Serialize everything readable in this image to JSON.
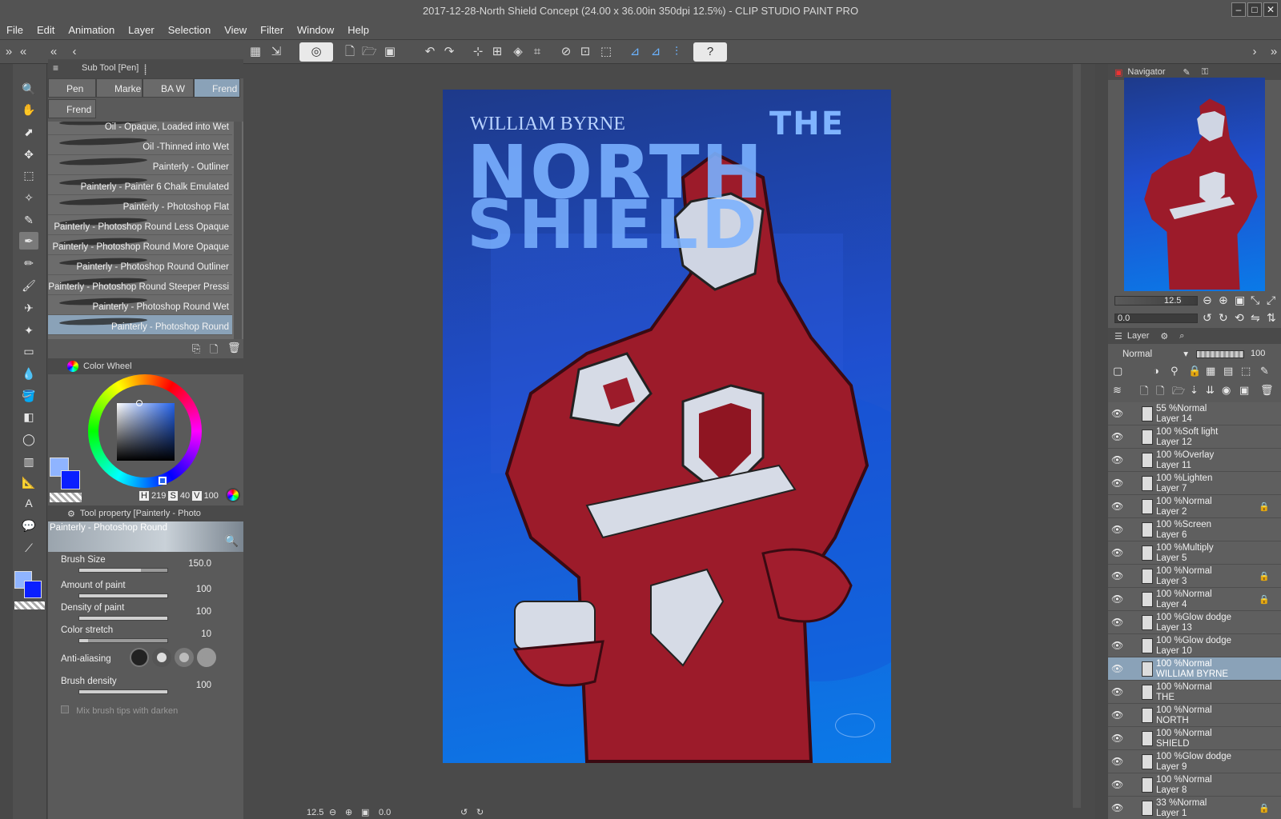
{
  "window": {
    "title": "2017-12-28-North Shield Concept (24.00 x 36.00in 350dpi 12.5%)  - CLIP STUDIO PAINT PRO"
  },
  "menu": [
    "File",
    "Edit",
    "Animation",
    "Layer",
    "Selection",
    "View",
    "Filter",
    "Window",
    "Help"
  ],
  "subtool_panel": {
    "title": "Sub Tool [Pen]",
    "tabs": [
      "Pen",
      "Marke",
      "BA W",
      "Frend",
      "Frend"
    ],
    "brushes": [
      "Oil - Opaque, Loaded into Wet",
      "Oil -Thinned into Wet",
      "Painterly - Outliner",
      "Painterly - Painter 6 Chalk Emulated",
      "Painterly - Photoshop Flat",
      "Painterly - Photoshop Round Less Opaque",
      "Painterly - Photoshop Round More Opaque",
      "Painterly - Photoshop Round Outliner",
      "Painterly - Photoshop Round Steeper Pressi",
      "Painterly - Photoshop Round Wet",
      "Painterly - Photoshop Round"
    ],
    "selected_index": 10
  },
  "color_wheel": {
    "title": "Color Wheel",
    "h_label": "H",
    "h": "219",
    "s_label": "S",
    "s": "40",
    "v_label": "V",
    "v": "100",
    "main_color": "#8fb4ff",
    "sub_color": "#0a1fff"
  },
  "tool_property": {
    "title": "Tool property [Painterly - Photo",
    "brush_name": "Painterly - Photoshop Round",
    "props": [
      {
        "label": "Brush Size",
        "value": "150.0",
        "fill": 0.7
      },
      {
        "label": "Amount of paint",
        "value": "100",
        "fill": 1.0
      },
      {
        "label": "Density of paint",
        "value": "100",
        "fill": 1.0
      },
      {
        "label": "Color stretch",
        "value": "10",
        "fill": 0.1
      }
    ],
    "antialias_label": "Anti-aliasing",
    "brush_density_label": "Brush density",
    "brush_density_value": "100",
    "mix_label": "Mix brush tips with darken"
  },
  "artwork": {
    "author": "WILLIAM BYRNE",
    "title_the": "THE",
    "title_north": "NORTH",
    "title_shield": "SHIELD"
  },
  "navigator": {
    "title": "Navigator",
    "zoom": "12.5",
    "rotation": "0.0"
  },
  "layer_panel": {
    "title": "Layer",
    "blend_mode": "Normal",
    "opacity": "100",
    "layers": [
      {
        "mode": "55 %Normal",
        "name": "Layer 14",
        "lock": false
      },
      {
        "mode": "100 %Soft light",
        "name": "Layer 12",
        "lock": false
      },
      {
        "mode": "100 %Overlay",
        "name": "Layer 11",
        "lock": false
      },
      {
        "mode": "100 %Lighten",
        "name": "Layer 7",
        "lock": false
      },
      {
        "mode": "100 %Normal",
        "name": "Layer 2",
        "lock": true
      },
      {
        "mode": "100 %Screen",
        "name": "Layer 6",
        "lock": false
      },
      {
        "mode": "100 %Multiply",
        "name": "Layer 5",
        "lock": false
      },
      {
        "mode": "100 %Normal",
        "name": "Layer 3",
        "lock": true
      },
      {
        "mode": "100 %Normal",
        "name": "Layer 4",
        "lock": true
      },
      {
        "mode": "100 %Glow dodge",
        "name": "Layer 13",
        "lock": false
      },
      {
        "mode": "100 %Glow dodge",
        "name": "Layer 10",
        "lock": false
      },
      {
        "mode": "100 %Normal",
        "name": "WILLIAM BYRNE",
        "lock": false
      },
      {
        "mode": "100 %Normal",
        "name": "THE",
        "lock": false
      },
      {
        "mode": "100 %Normal",
        "name": "NORTH",
        "lock": false
      },
      {
        "mode": "100 %Normal",
        "name": "SHIELD",
        "lock": false
      },
      {
        "mode": "100 %Glow dodge",
        "name": "Layer 9",
        "lock": false
      },
      {
        "mode": "100 %Normal",
        "name": "Layer 8",
        "lock": false
      },
      {
        "mode": "33 %Normal",
        "name": "Layer 1",
        "lock": true
      }
    ],
    "selected_index": 11
  },
  "status": {
    "zoom": "12.5",
    "rotation": "0.0"
  }
}
